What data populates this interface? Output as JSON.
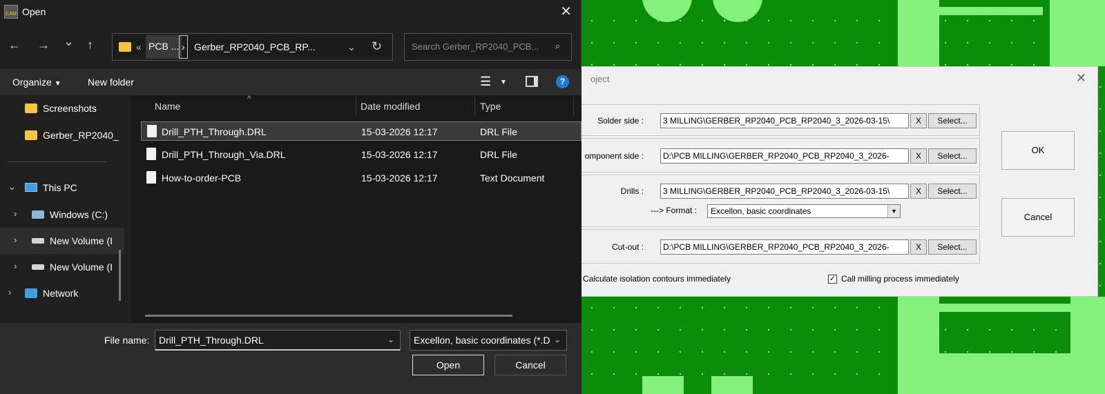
{
  "open_dialog": {
    "title": "Open",
    "nav": {
      "back": "←",
      "forward": "→",
      "recent": "⌄",
      "up": "↑"
    },
    "address": {
      "crumb_prefix": "«",
      "crumb_parent": "PCB ...",
      "separator": "›",
      "crumb_current": "Gerber_RP2040_PCB_RP..."
    },
    "search": {
      "placeholder": "Search Gerber_RP2040_PCB..."
    },
    "toolbar": {
      "organize": "Organize",
      "new_folder": "New folder"
    },
    "sidebar": {
      "items": [
        {
          "label": "Screenshots"
        },
        {
          "label": "Gerber_RP2040_"
        },
        {
          "label": "This PC"
        },
        {
          "label": "Windows (C:)"
        },
        {
          "label": "New Volume (I"
        },
        {
          "label": "New Volume (I"
        },
        {
          "label": "Network"
        }
      ]
    },
    "columns": {
      "name": "Name",
      "date": "Date modified",
      "type": "Type"
    },
    "files": [
      {
        "name": "Drill_PTH_Through.DRL",
        "date": "15-03-2026 12:17",
        "type": "DRL File"
      },
      {
        "name": "Drill_PTH_Through_Via.DRL",
        "date": "15-03-2026 12:17",
        "type": "DRL File"
      },
      {
        "name": "How-to-order-PCB",
        "date": "15-03-2026 12:17",
        "type": "Text Document"
      }
    ],
    "file_name_label": "File name:",
    "file_name_value": "Drill_PTH_Through.DRL",
    "file_type": "Excellon, basic coordinates  (*.D",
    "open_button": "Open",
    "cancel_button": "Cancel"
  },
  "project_dialog": {
    "title_fragment": "oject",
    "solder_side": {
      "label": "Solder side :",
      "value": "3 MILLING\\GERBER_RP2040_PCB_RP2040_3_2026-03-15\\",
      "x": "X",
      "select": "Select..."
    },
    "component_side": {
      "label": "omponent side :",
      "value": "D:\\PCB MILLING\\GERBER_RP2040_PCB_RP2040_3_2026-",
      "x": "X",
      "select": "Select..."
    },
    "drills": {
      "label": "Drills :",
      "value": "3 MILLING\\GERBER_RP2040_PCB_RP2040_3_2026-03-15\\",
      "x": "X",
      "select": "Select...",
      "format_label": "---> Format :",
      "format_value": "Excellon, basic coordinates"
    },
    "cutout": {
      "label": "Cut-out :",
      "value": "D:\\PCB MILLING\\GERBER_RP2040_PCB_RP2040_3_2026-",
      "x": "X",
      "select": "Select..."
    },
    "ok": "OK",
    "cancel": "Cancel",
    "calc_isolation": "Calculate isolation contours immediately",
    "call_milling": "Call milling process immediately"
  }
}
